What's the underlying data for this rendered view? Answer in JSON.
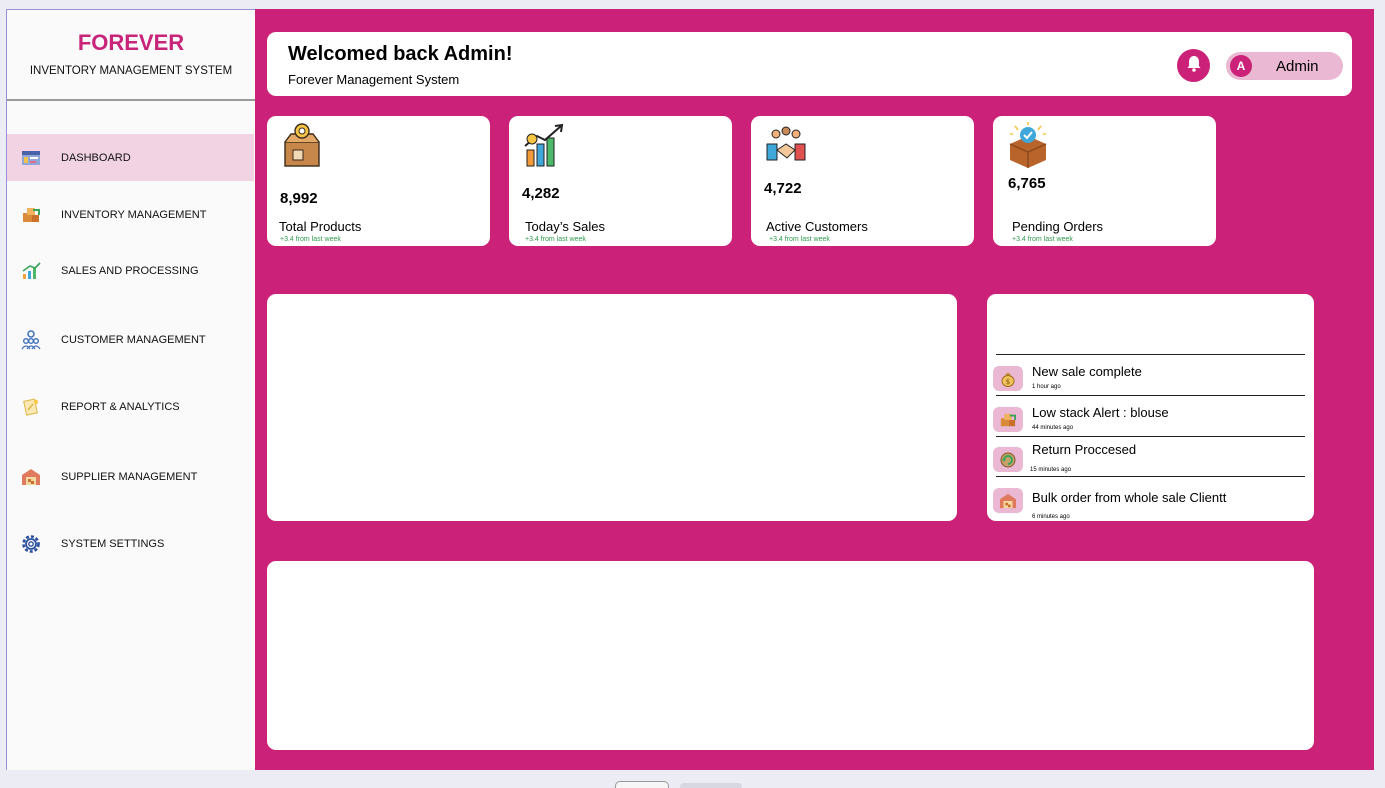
{
  "brand": {
    "title": "FOREVER",
    "subtitle": "INVENTORY MANAGEMENT SYSTEM"
  },
  "nav": [
    {
      "label": "DASHBOARD",
      "icon": "dashboard-icon",
      "active": true
    },
    {
      "label": "INVENTORY MANAGEMENT",
      "icon": "boxes-icon"
    },
    {
      "label": "SALES AND PROCESSING",
      "icon": "bar-chart-icon"
    },
    {
      "label": "CUSTOMER MANAGEMENT",
      "icon": "people-icon"
    },
    {
      "label": "REPORT & ANALYTICS",
      "icon": "report-icon"
    },
    {
      "label": "SUPPLIER MANAGEMENT",
      "icon": "warehouse-icon"
    },
    {
      "label": "SYSTEM SETTINGS",
      "icon": "gear-icon"
    }
  ],
  "header": {
    "title": "Welcomed back Admin!",
    "subtitle": "Forever Management System",
    "avatar_initial": "A",
    "user_name": "Admin"
  },
  "stats": [
    {
      "value": "8,992",
      "label": "Total Products",
      "trend": "+3.4 from last week",
      "icon": "product-box-icon"
    },
    {
      "value": "4,282",
      "label": "Today’s Sales",
      "trend": "+3.4 from last week",
      "icon": "sales-growth-icon"
    },
    {
      "value": "4,722",
      "label": "Active Customers",
      "trend": "+3.4 from last week",
      "icon": "handshake-icon"
    },
    {
      "value": "6,765",
      "label": "Pending Orders",
      "trend": "+3.4 from last week",
      "icon": "order-box-icon"
    }
  ],
  "activity": [
    {
      "title": "New sale complete",
      "time": "1 hour  ago",
      "icon": "money-bag-icon"
    },
    {
      "title": "Low stack Alert : blouse",
      "time": "44  minutes  ago",
      "icon": "boxes-icon"
    },
    {
      "title": "Return Proccesed",
      "time": "15  minutes  ago",
      "icon": "return-icon"
    },
    {
      "title": "Bulk order from whole sale Clientt",
      "time": "6  minutes  ago",
      "icon": "warehouse-icon"
    }
  ],
  "colors": {
    "brand": "#cb2178",
    "active_nav": "#f1d3e3",
    "pill": "#eab8d2",
    "trend": "#2e9a4c"
  }
}
